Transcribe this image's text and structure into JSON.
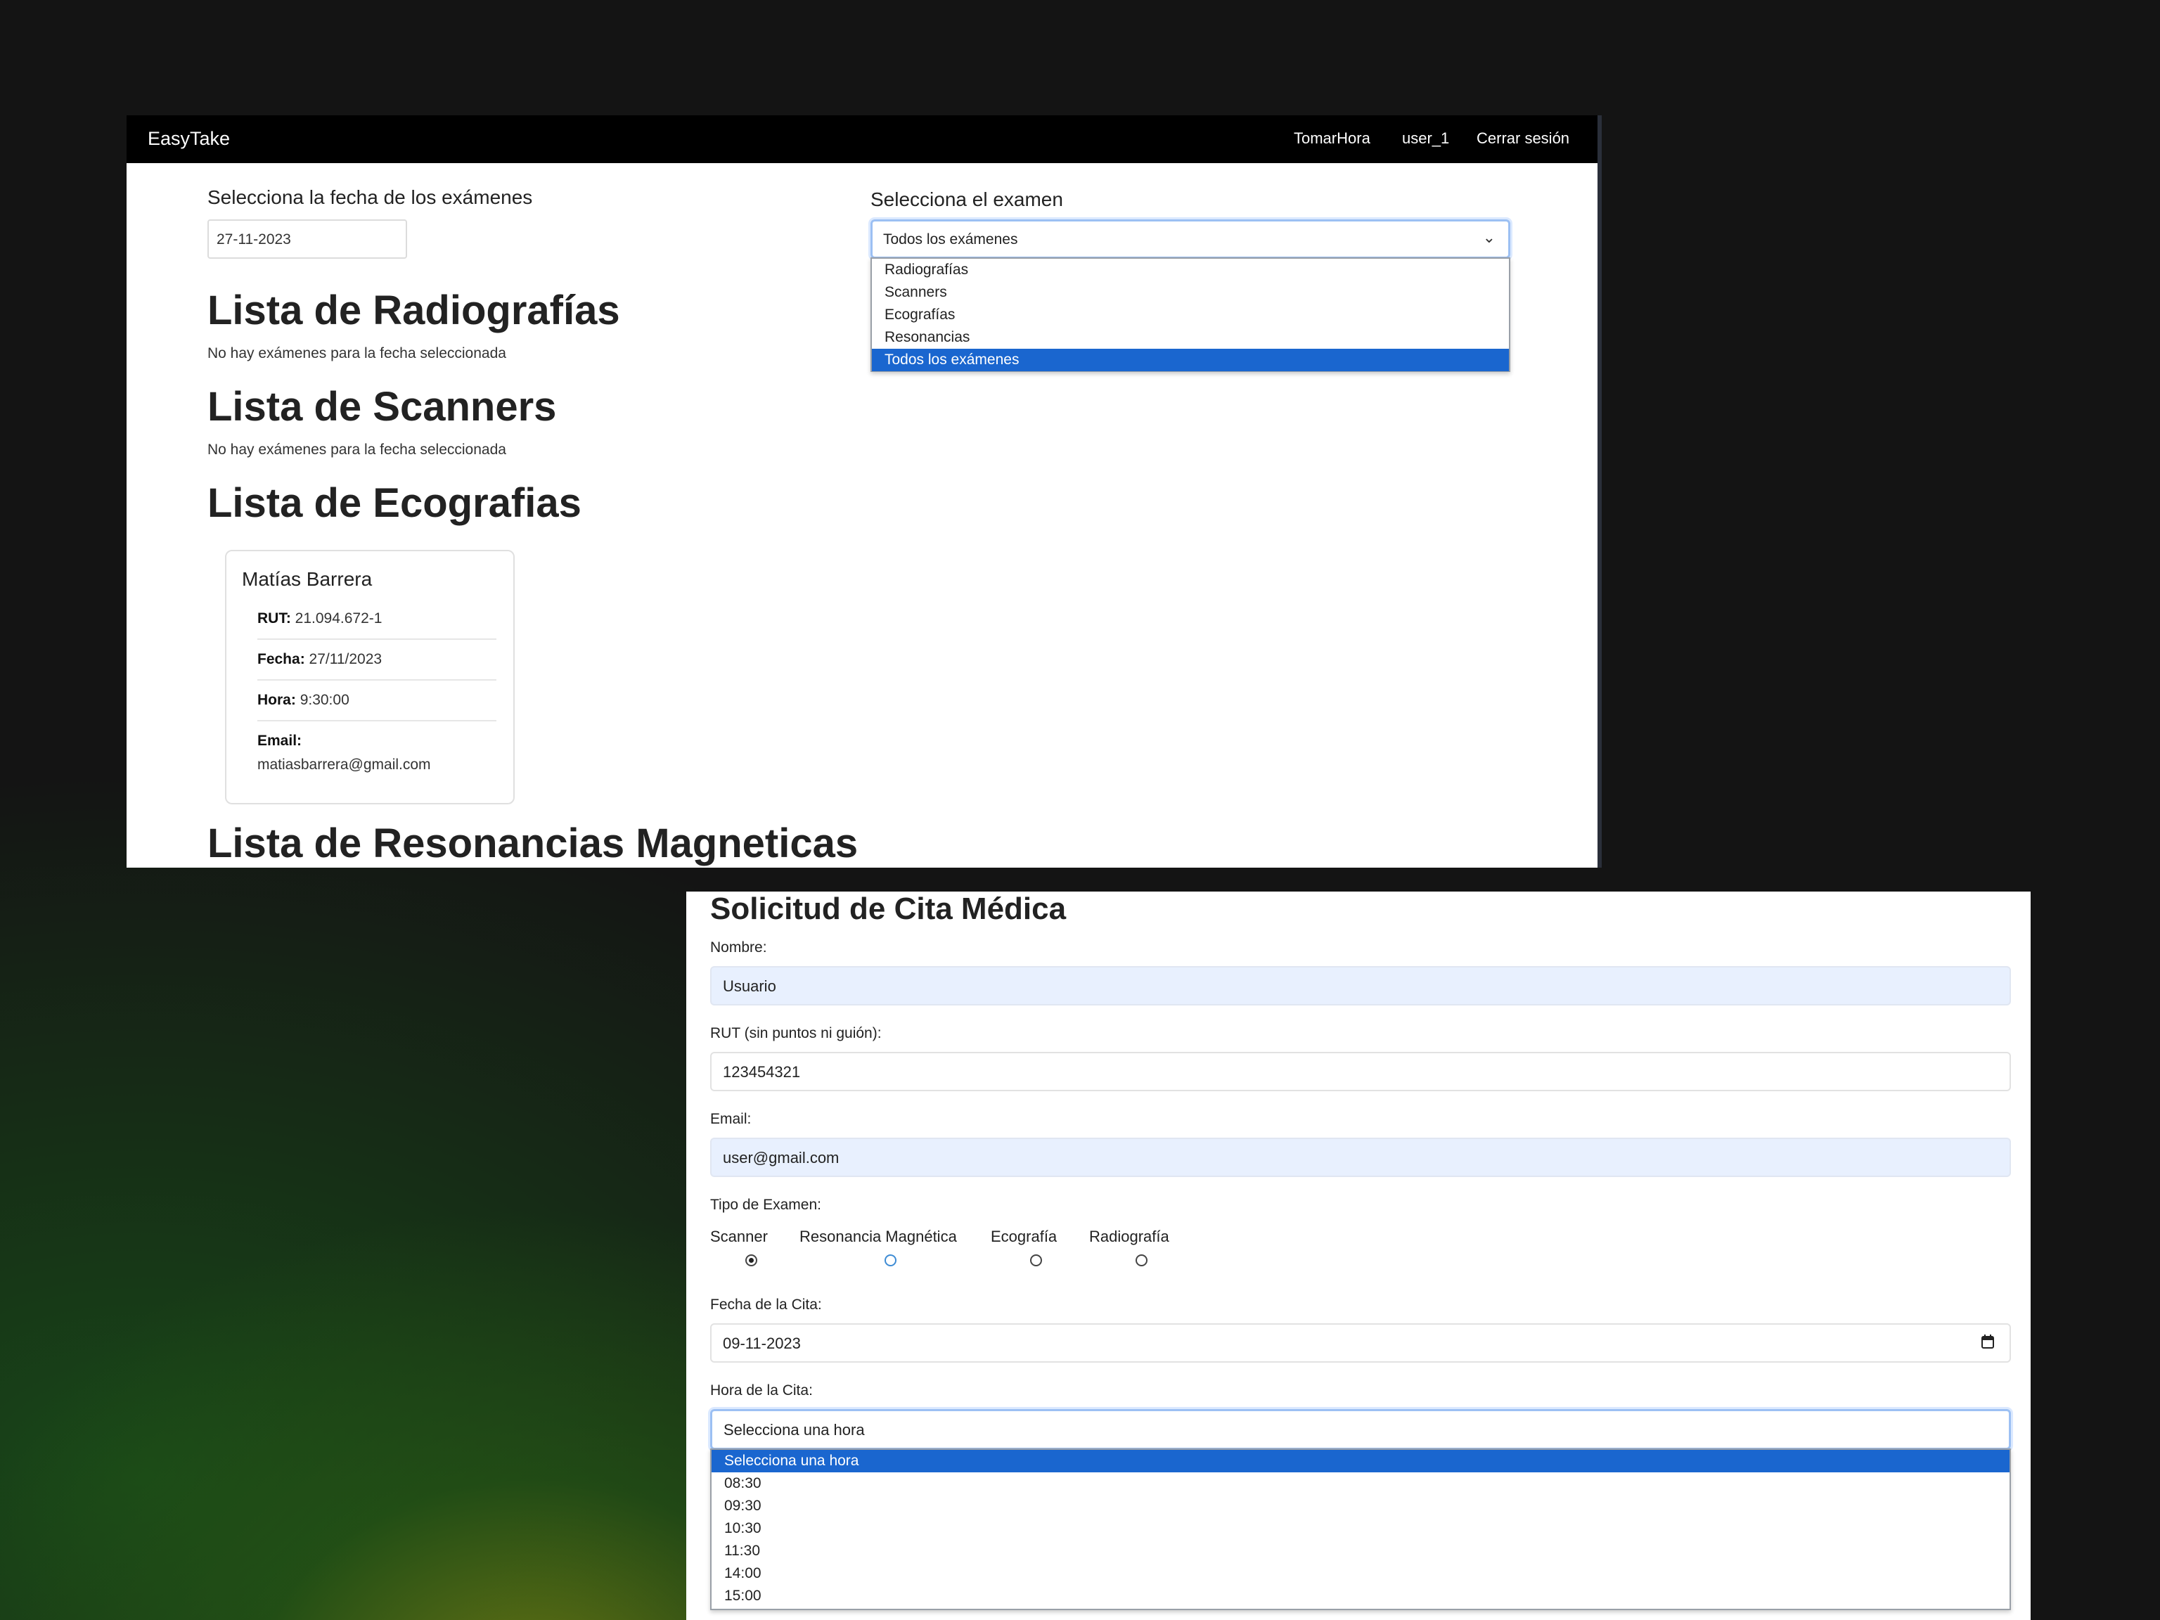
{
  "navbar": {
    "brand": "EasyTake",
    "links": [
      "TomarHora",
      "user_1",
      "Cerrar sesión"
    ]
  },
  "filters": {
    "date_label": "Selecciona la fecha de los exámenes",
    "date_value": "27-11-2023",
    "exam_label": "Selecciona el examen",
    "exam_selected": "Todos los exámenes",
    "exam_options": [
      "Radiografías",
      "Scanners",
      "Ecografías",
      "Resonancias",
      "Todos los exámenes"
    ]
  },
  "lists": [
    {
      "title": "Lista de Radiografías",
      "empty": "No hay exámenes para la fecha seleccionada"
    },
    {
      "title": "Lista de Scanners",
      "empty": "No hay exámenes para la fecha seleccionada"
    },
    {
      "title": "Lista de Ecografias"
    },
    {
      "title": "Lista de Resonancias Magneticas"
    }
  ],
  "card": {
    "name": "Matías Barrera",
    "rut_label": "RUT:",
    "rut": "21.094.672-1",
    "fecha_label": "Fecha:",
    "fecha": "27/11/2023",
    "hora_label": "Hora:",
    "hora": "9:30:00",
    "email_label": "Email:",
    "email": "matiasbarrera@gmail.com"
  },
  "form": {
    "title": "Solicitud de Cita Médica",
    "nombre_label": "Nombre:",
    "nombre_value": "Usuario",
    "rut_label": "RUT (sin puntos ni guión):",
    "rut_value": "123454321",
    "email_label": "Email:",
    "email_value": "user@gmail.com",
    "tipo_label": "Tipo de Examen:",
    "tipo_options": [
      "Scanner",
      "Resonancia Magnética",
      "Ecografía",
      "Radiografía"
    ],
    "tipo_selected": "Scanner",
    "fecha_label": "Fecha de la Cita:",
    "fecha_value": "09-11-2023",
    "hora_label": "Hora de la Cita:",
    "hora_selected": "Selecciona una hora",
    "hora_options": [
      "Selecciona una hora",
      "08:30",
      "09:30",
      "10:30",
      "11:30",
      "14:00",
      "15:00"
    ]
  },
  "colors": {
    "navbar_bg": "#000000",
    "selected_option": "#1a66cf",
    "autofill_bg": "#e8f0fe",
    "focus_border": "#9cc0f3"
  }
}
